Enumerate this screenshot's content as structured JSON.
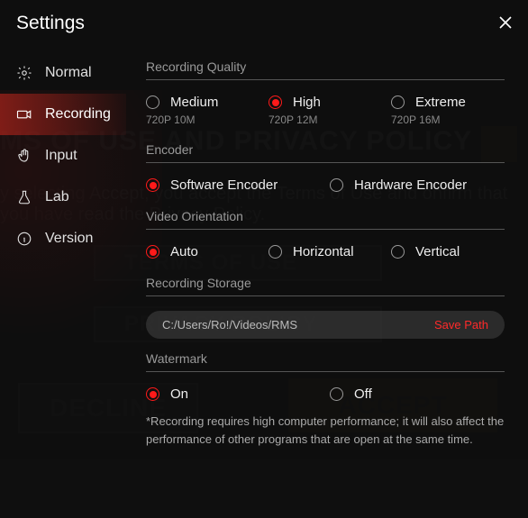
{
  "header": {
    "title": "Settings"
  },
  "sidebar": {
    "items": [
      {
        "key": "normal",
        "label": "Normal",
        "icon": "gear-icon"
      },
      {
        "key": "recording",
        "label": "Recording",
        "icon": "camera-icon",
        "active": true
      },
      {
        "key": "input",
        "label": "Input",
        "icon": "hand-icon"
      },
      {
        "key": "lab",
        "label": "Lab",
        "icon": "flask-icon"
      },
      {
        "key": "version",
        "label": "Version",
        "icon": "info-icon"
      }
    ]
  },
  "panel": {
    "quality": {
      "title": "Recording Quality",
      "options": [
        {
          "label": "Medium",
          "sub": "720P 10M",
          "checked": false
        },
        {
          "label": "High",
          "sub": "720P 12M",
          "checked": true
        },
        {
          "label": "Extreme",
          "sub": "720P 16M",
          "checked": false
        }
      ]
    },
    "encoder": {
      "title": "Encoder",
      "options": [
        {
          "label": "Software Encoder",
          "checked": true
        },
        {
          "label": "Hardware Encoder",
          "checked": false
        }
      ]
    },
    "orientation": {
      "title": "Video Orientation",
      "options": [
        {
          "label": "Auto",
          "checked": true
        },
        {
          "label": "Horizontal",
          "checked": false
        },
        {
          "label": "Vertical",
          "checked": false
        }
      ]
    },
    "storage": {
      "title": "Recording Storage",
      "path": "C:/Users/Ro!/Videos/RMS",
      "save_label": "Save Path"
    },
    "watermark": {
      "title": "Watermark",
      "options": [
        {
          "label": "On",
          "checked": true
        },
        {
          "label": "Off",
          "checked": false
        }
      ]
    },
    "note": "*Recording requires high computer performance; it will also affect the performance of other programs that are open at the same time."
  },
  "ghost": {
    "title": "MS OF USE AND PRIVACY POLICY",
    "text": "y selecting Accept, you accept the Terms of Use and onfirm that you have read the Privacy Policy.",
    "tou": "TERMS OF USE",
    "pp": "PRIVACY POLICY",
    "decline": "DECLINE",
    "accept": "ACCEPT"
  }
}
